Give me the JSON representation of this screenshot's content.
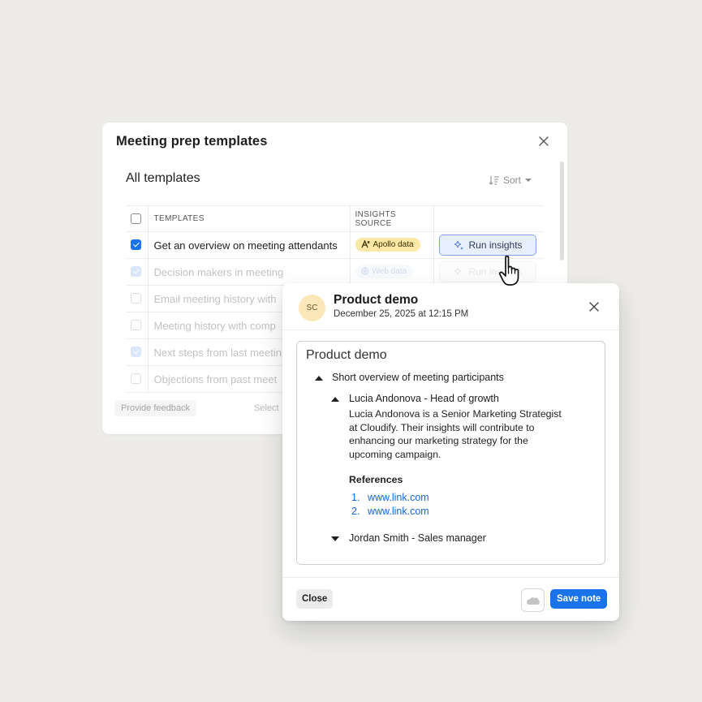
{
  "templates_panel": {
    "title": "Meeting prep templates",
    "subtitle": "All templates",
    "sort_label": "Sort",
    "columns": [
      "TEMPLATES",
      "INSIGHTS SOURCE"
    ],
    "rows": [
      {
        "name": "Get an overview on meeting attendants",
        "checked": true,
        "source": "Apollo data",
        "action": "Run insights"
      },
      {
        "name": "Decision makers in meeting",
        "checked": true,
        "source": "Web data",
        "action": "Run insights"
      },
      {
        "name": "Email meeting history with",
        "checked": false,
        "source": "",
        "action": ""
      },
      {
        "name": "Meeting history with comp",
        "checked": false,
        "source": "",
        "action": ""
      },
      {
        "name": "Next steps from last meetin",
        "checked": true,
        "source": "",
        "action": ""
      },
      {
        "name": "Objections from past meet",
        "checked": false,
        "source": "",
        "action": ""
      }
    ],
    "feedback_label": "Provide feedback",
    "select_label": "Select"
  },
  "note_modal": {
    "avatar_initials": "SC",
    "title": "Product demo",
    "date": "December 25, 2025 at 12:15 PM",
    "note": {
      "title": "Product demo",
      "section": "Short overview of meeting participants",
      "person1": {
        "heading": "Lucia Andonova - Head of growth",
        "paragraph_lines": [
          "Lucia Andonova is a Senior Marketing Strategist",
          "at Cloudify. Their insights will contribute to",
          "enhancing our marketing strategy for the",
          "upcoming campaign."
        ]
      },
      "references_label": "References",
      "references": [
        {
          "num": "1.",
          "url": "www.link.com"
        },
        {
          "num": "2.",
          "url": "www.link.com"
        }
      ],
      "person2": {
        "heading": "Jordan Smith -  Sales manager"
      }
    },
    "close_label": "Close",
    "save_label": "Save note"
  },
  "colors": {
    "primary": "#1a73e8",
    "apollo_badge": "#fbe7a6",
    "background": "#edece8"
  }
}
